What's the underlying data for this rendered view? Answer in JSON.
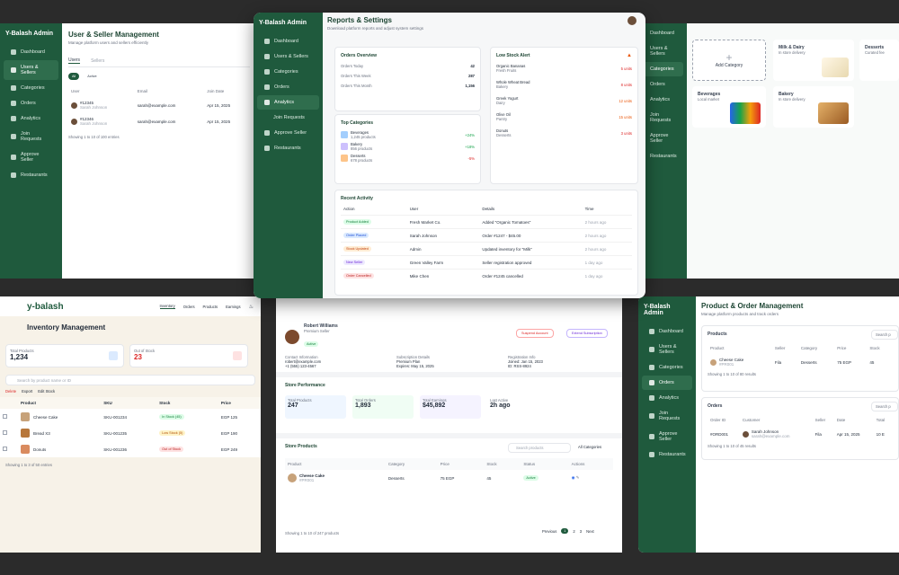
{
  "p1": {
    "brand": "Y-Balash Admin",
    "nav": [
      "Dashboard",
      "Users & Sellers",
      "Categories",
      "Orders",
      "Analytics",
      "Join Requests",
      "Approve Seller",
      "Restaurants"
    ],
    "title": "User & Seller Management",
    "subtitle": "Manage platform users and sellers efficiently",
    "tabs": [
      "Users",
      "Sellers"
    ],
    "filters": [
      "All",
      "Active"
    ],
    "cols": [
      "User",
      "Email",
      "Join Date"
    ],
    "rows": [
      {
        "id": "#12345",
        "name": "Sarah Johnson",
        "email": "sarah@example.com",
        "date": "Apr 15, 2025"
      },
      {
        "id": "#12346",
        "name": "Sarah Johnson",
        "email": "sarah@example.com",
        "date": "Apr 15, 2025"
      }
    ],
    "footer": "Showing 1 to 10 of 100 entries"
  },
  "p2": {
    "brand": "Y-Balash Admin",
    "nav": [
      "Dashboard",
      "Users & Sellers",
      "Categories",
      "Orders",
      "Analytics",
      "Join Requests",
      "Approve Seller",
      "Restaurants"
    ],
    "title": "Reports & Settings",
    "subtitle": "Download platform reports and adjust system settings",
    "orders_title": "Orders Overview",
    "orders": [
      {
        "label": "Orders Today",
        "value": "42"
      },
      {
        "label": "Orders This Week",
        "value": "287"
      },
      {
        "label": "Orders This Month",
        "value": "1,156"
      }
    ],
    "cats_title": "Top Categories",
    "cats": [
      {
        "name": "Beverages",
        "sub": "1,245 products",
        "change": "+24%"
      },
      {
        "name": "Bakery",
        "sub": "856 products",
        "change": "+18%"
      },
      {
        "name": "Desserts",
        "sub": "678 products",
        "change": "-5%"
      }
    ],
    "low_title": "Low Stock Alert",
    "low": [
      {
        "name": "Organic Bananas",
        "sub": "Fresh Fruits",
        "qty": "5 units"
      },
      {
        "name": "Whole Wheat Bread",
        "sub": "Bakery",
        "qty": "8 units"
      },
      {
        "name": "Greek Yogurt",
        "sub": "Dairy",
        "qty": "12 units"
      },
      {
        "name": "Olive Oil",
        "sub": "Pantry",
        "qty": "15 units"
      },
      {
        "name": "Donuts",
        "sub": "Desserts",
        "qty": "3 units"
      }
    ],
    "activity_title": "Recent Activity",
    "activity_cols": [
      "Action",
      "User",
      "Details",
      "Time"
    ],
    "activity": [
      {
        "action": "Product Added",
        "user": "Fresh Market Co.",
        "details": "Added \"Organic Tomatoes\"",
        "time": "2 hours ago"
      },
      {
        "action": "Order Placed",
        "user": "Sarah Johnson",
        "details": "Order #1247 - $45.00",
        "time": "2 hours ago"
      },
      {
        "action": "Stock Updated",
        "user": "Admin",
        "details": "Updated inventory for \"Milk\"",
        "time": "2 hours ago"
      },
      {
        "action": "New Seller",
        "user": "Green Valley Farm",
        "details": "Seller registration approved",
        "time": "1 day ago"
      },
      {
        "action": "Order Cancelled",
        "user": "Mike Chen",
        "details": "Order #1245 cancelled",
        "time": "1 day ago"
      }
    ]
  },
  "p3": {
    "nav": [
      "Dashboard",
      "Users & Sellers",
      "Categories",
      "Orders",
      "Analytics",
      "Join Requests",
      "Approve Seller",
      "Restaurants"
    ],
    "add": "Add Category",
    "cats": [
      {
        "name": "Milk & Dairy",
        "sub": "In store delivery"
      },
      {
        "name": "Desserts",
        "sub": "Curated fee"
      },
      {
        "name": "Beverages",
        "sub": "Local market"
      },
      {
        "name": "Bakery",
        "sub": "In store delivery"
      }
    ]
  },
  "p4": {
    "logo": "y-balash",
    "nav": [
      "Inventory",
      "Orders",
      "Products",
      "Earnings"
    ],
    "title": "Inventory Management",
    "stats": [
      {
        "label": "Total Products",
        "value": "1,234"
      },
      {
        "label": "Out of Stock",
        "value": "23"
      }
    ],
    "search": "Search by product name or ID",
    "actions": [
      "Delete",
      "Export",
      "Edit Stock"
    ],
    "cols": [
      "Product",
      "SKU",
      "Stock",
      "Price"
    ],
    "rows": [
      {
        "name": "Cheese Cake",
        "sku": "SKU-001234",
        "stock": "In Stock (45)",
        "price": "EGP 125"
      },
      {
        "name": "Bread X3",
        "sku": "SKU-001235",
        "stock": "Low Stock (5)",
        "price": "EGP 190"
      },
      {
        "name": "Donuts",
        "sku": "SKU-001236",
        "stock": "Out of Stock",
        "price": "EGP 249"
      }
    ],
    "footer": "Showing 1 to 3 of 50 entries"
  },
  "p5": {
    "name": "Robert Williams",
    "tier": "Premium Seller",
    "status": "Active",
    "btn_suspend": "Suspend Account",
    "btn_extend": "Extend Subscription",
    "contact_label": "Contact Information",
    "email": "robert@example.com",
    "phone": "+1 (555) 123-4567",
    "sub_label": "Subscription Details",
    "plan": "Premium Plan",
    "expires": "Expires: May 15, 2025",
    "reg_label": "Registration Info",
    "joined": "Joined: Jan 15, 2023",
    "reg_id": "ID: RSS-8924",
    "perf_title": "Store Performance",
    "perf": [
      {
        "label": "Total Products",
        "value": "247"
      },
      {
        "label": "Total Orders",
        "value": "1,893"
      },
      {
        "label": "Total Earnings",
        "value": "$45,892"
      },
      {
        "label": "Last Active",
        "value": "2h ago"
      }
    ],
    "prod_title": "Store Products",
    "prod_search": "Search products",
    "prod_filter": "All Categories",
    "prod_cols": [
      "Product",
      "Category",
      "Price",
      "Stock",
      "Status",
      "Actions"
    ],
    "prod_row": {
      "name": "Cheese Cake",
      "id": "#PR001",
      "cat": "Desserts",
      "price": "75 EGP",
      "stock": "45",
      "status": "Active"
    },
    "prod_footer": "Showing 1 to 10 of 247 products",
    "pager": [
      "Previous",
      "1",
      "2",
      "3",
      "Next"
    ]
  },
  "p6": {
    "brand": "Y-Balash Admin",
    "nav": [
      "Dashboard",
      "Users & Sellers",
      "Categories",
      "Orders",
      "Analytics",
      "Join Requests",
      "Approve Seller",
      "Restaurants"
    ],
    "title": "Product & Order Management",
    "subtitle": "Manage platform products and track orders",
    "products_title": "Products",
    "search": "Search p",
    "prod_cols": [
      "Product",
      "Seller",
      "Category",
      "Price",
      "Stock"
    ],
    "prod_row": {
      "name": "Cheese Cake",
      "id": "#PR001",
      "seller": "Fila",
      "cat": "Desserts",
      "price": "75 EGP",
      "stock": "45"
    },
    "prod_footer": "Showing 1 to 10 of 80 results",
    "orders_title": "Orders",
    "order_cols": [
      "Order ID",
      "Customer",
      "Seller",
      "Date",
      "Total"
    ],
    "order_row": {
      "id": "#ORD001",
      "customer": "Sarah Johnson",
      "email": "sarah@example.com",
      "seller": "Fila",
      "date": "Apr 15, 2025",
      "total": "10 E"
    },
    "order_footer": "Showing 1 to 10 of 45 results"
  }
}
